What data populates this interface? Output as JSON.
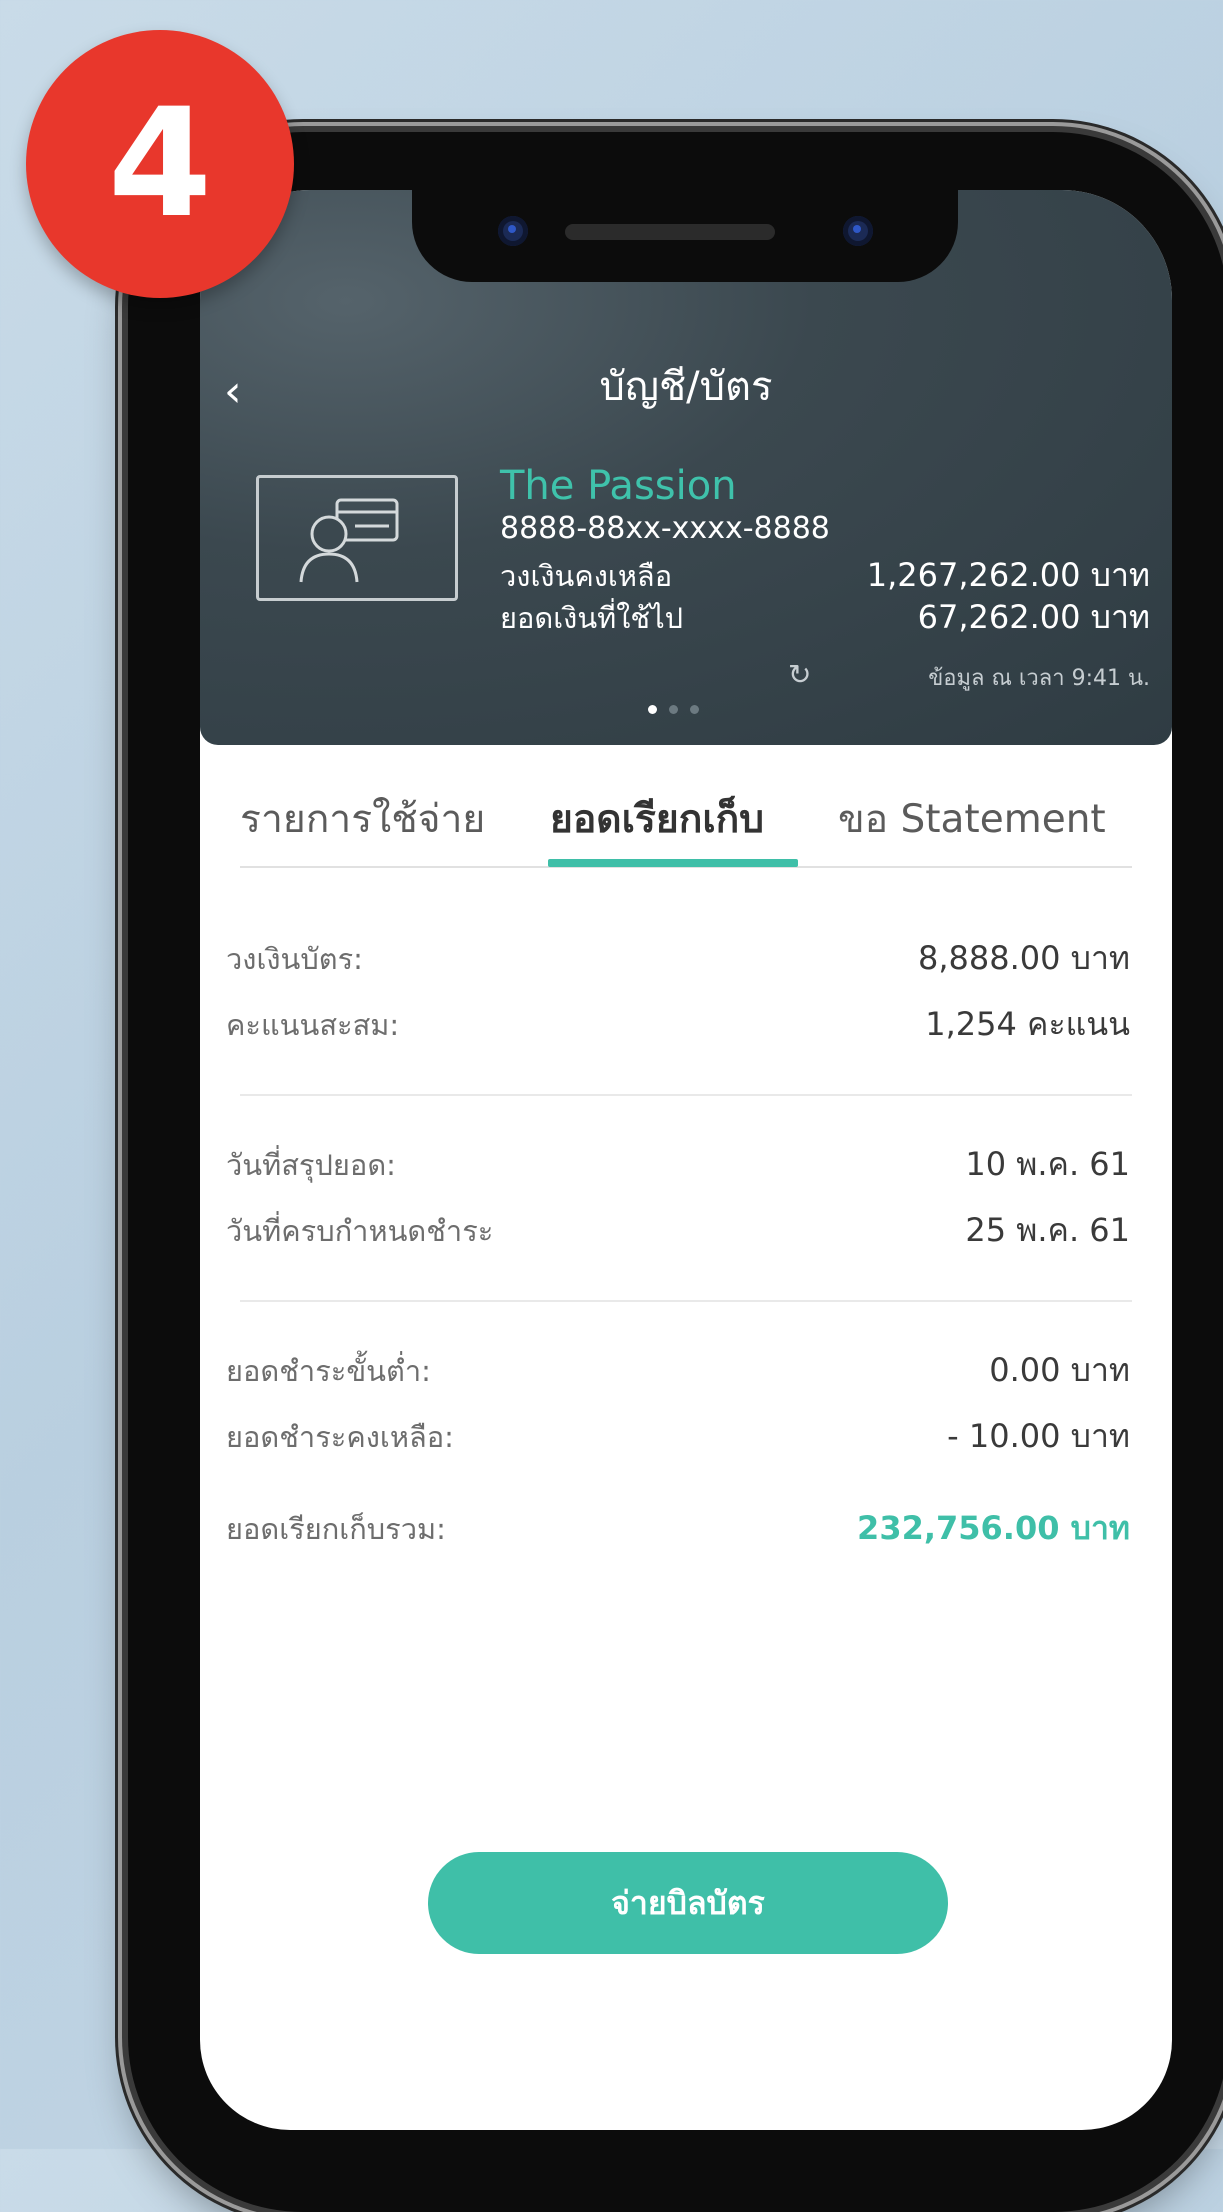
{
  "step_badge": "4",
  "header": {
    "title": "บัญชี/บัตร",
    "back_icon": "chevron-left-icon",
    "card": {
      "name": "The Passion",
      "number": "8888-88xx-xxxx-8888",
      "rows": [
        {
          "label": "วงเงินคงเหลือ",
          "value": "1,267,262.00 บาท"
        },
        {
          "label": "ยอดเงินที่ใช้ไป",
          "value": "67,262.00 บาท"
        }
      ],
      "updated_text": "ข้อมูล ณ เวลา 9:41 น.",
      "page_dots": 3,
      "active_dot": 0
    }
  },
  "tabs": [
    {
      "label": "รายการใช้จ่าย",
      "active": false
    },
    {
      "label": "ยอดเรียกเก็บ",
      "active": true
    },
    {
      "label": "ขอ Statement",
      "active": false
    }
  ],
  "details": {
    "limit_label": "วงเงินบัตร:",
    "limit_value": "8,888.00 บาท",
    "points_label": "คะแนนสะสม:",
    "points_value": "1,254 คะแนน",
    "statement_date_label": "วันที่สรุปยอด:",
    "statement_date_value": "10 พ.ค. 61",
    "due_date_label": "วันที่ครบกำหนดชำระ",
    "due_date_value": "25 พ.ค. 61",
    "min_pay_label": "ยอดชำระขั้นต่ำ:",
    "min_pay_value": "0.00 บาท",
    "remaining_label": "ยอดชำระคงเหลือ:",
    "remaining_value": "- 10.00 บาท",
    "total_label": "ยอดเรียกเก็บรวม:",
    "total_value": "232,756.00 บาท"
  },
  "pay_button": "จ่ายบิลบัตร",
  "colors": {
    "accent": "#3fbfa8",
    "badge": "#e8372c",
    "header_bg": "#3b484f"
  }
}
